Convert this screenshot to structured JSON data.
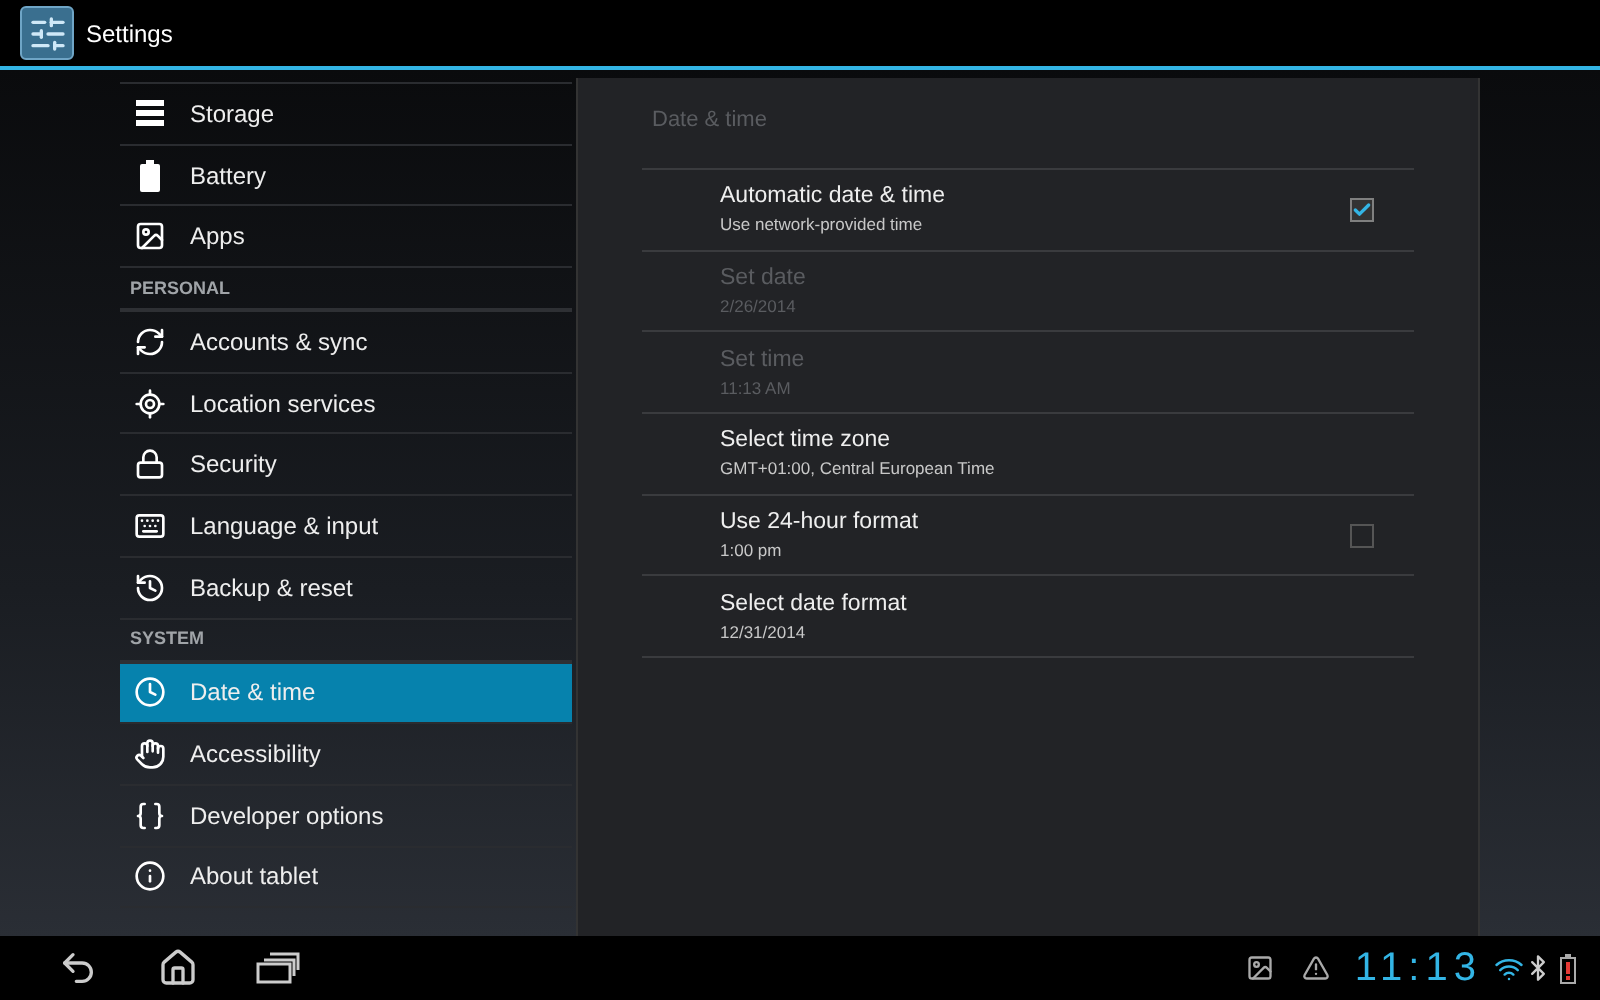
{
  "app_bar": {
    "title": "Settings"
  },
  "sidebar": {
    "items": [
      {
        "kind": "item",
        "label": "Storage",
        "selected": false
      },
      {
        "kind": "item",
        "label": "Battery",
        "selected": false
      },
      {
        "kind": "item",
        "label": "Apps",
        "selected": false
      },
      {
        "kind": "header",
        "label": "PERSONAL"
      },
      {
        "kind": "item",
        "label": "Accounts & sync",
        "selected": false
      },
      {
        "kind": "item",
        "label": "Location services",
        "selected": false
      },
      {
        "kind": "item",
        "label": "Security",
        "selected": false
      },
      {
        "kind": "item",
        "label": "Language & input",
        "selected": false
      },
      {
        "kind": "item",
        "label": "Backup & reset",
        "selected": false
      },
      {
        "kind": "header",
        "label": "SYSTEM"
      },
      {
        "kind": "item",
        "label": "Date & time",
        "selected": true
      },
      {
        "kind": "item",
        "label": "Accessibility",
        "selected": false
      },
      {
        "kind": "item",
        "label": "Developer options",
        "selected": false
      },
      {
        "kind": "item",
        "label": "About tablet",
        "selected": false
      }
    ]
  },
  "panel": {
    "title": "Date & time",
    "rows": [
      {
        "kind": "checkbox",
        "title": "Automatic date & time",
        "summary": "Use network-provided time",
        "checked": true,
        "disabled": false
      },
      {
        "kind": "plain",
        "title": "Set date",
        "summary": "2/26/2014",
        "disabled": true
      },
      {
        "kind": "plain",
        "title": "Set time",
        "summary": "11:13 AM",
        "disabled": true
      },
      {
        "kind": "plain",
        "title": "Select time zone",
        "summary": "GMT+01:00, Central European Time",
        "disabled": false
      },
      {
        "kind": "checkbox",
        "title": "Use 24-hour format",
        "summary": "1:00 pm",
        "checked": false,
        "disabled": false
      },
      {
        "kind": "plain",
        "title": "Select date format",
        "summary": "12/31/2014",
        "disabled": false
      }
    ]
  },
  "system_bar": {
    "time": "11:13"
  }
}
